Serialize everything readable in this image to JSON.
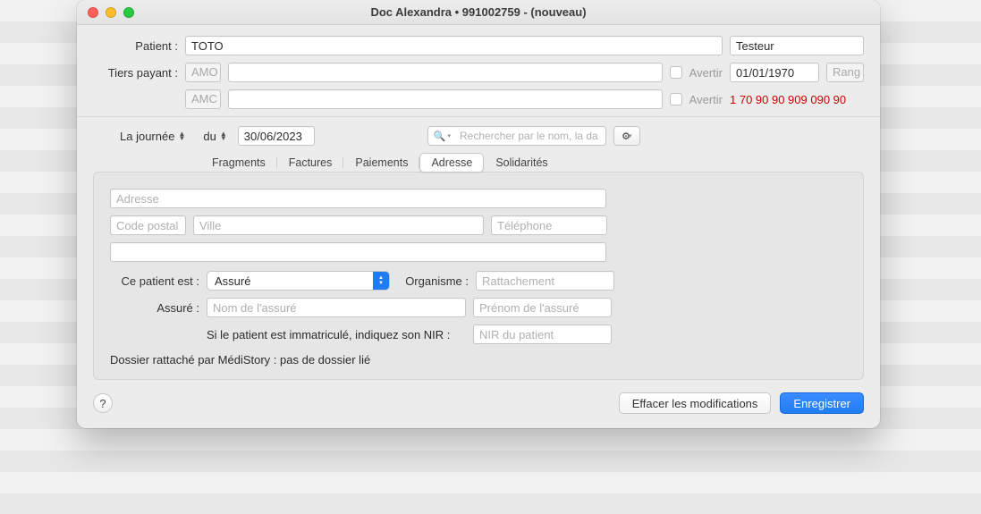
{
  "window": {
    "title": "Doc Alexandra • 991002759 - (nouveau)"
  },
  "header": {
    "patient_label": "Patient :",
    "patient_value": "TOTO",
    "tester_value": "Testeur",
    "tiers_label": "Tiers payant :",
    "amo_label": "AMO",
    "amc_label": "AMC",
    "avertir_label": "Avertir",
    "date_value": "01/01/1970",
    "rang_label": "Rang",
    "nss_value": "1 70 90 90 909 090 90"
  },
  "filters": {
    "scope": "La journée",
    "from_label": "du",
    "date": "30/06/2023",
    "search_placeholder": "Rechercher par le nom, la date"
  },
  "tabs": {
    "items": [
      "Fragments",
      "Factures",
      "Paiements",
      "Adresse",
      "Solidarités"
    ],
    "active_index": 3
  },
  "address": {
    "address_ph": "Adresse",
    "postal_ph": "Code postal",
    "city_ph": "Ville",
    "phone_ph": "Téléphone",
    "patient_is_label": "Ce patient est :",
    "patient_is_value": "Assuré",
    "organisme_label": "Organisme :",
    "organisme_ph": "Rattachement",
    "assure_label": "Assuré :",
    "assure_nom_ph": "Nom de l'assuré",
    "assure_prenom_ph": "Prénom de l'assuré",
    "nir_hint": "Si le patient est immatriculé, indiquez son NIR :",
    "nir_ph": "NIR du patient",
    "link_text": "Dossier rattaché par MédiStory : pas de dossier lié"
  },
  "footer": {
    "help": "?",
    "cancel": "Effacer les modifications",
    "save": "Enregistrer"
  }
}
